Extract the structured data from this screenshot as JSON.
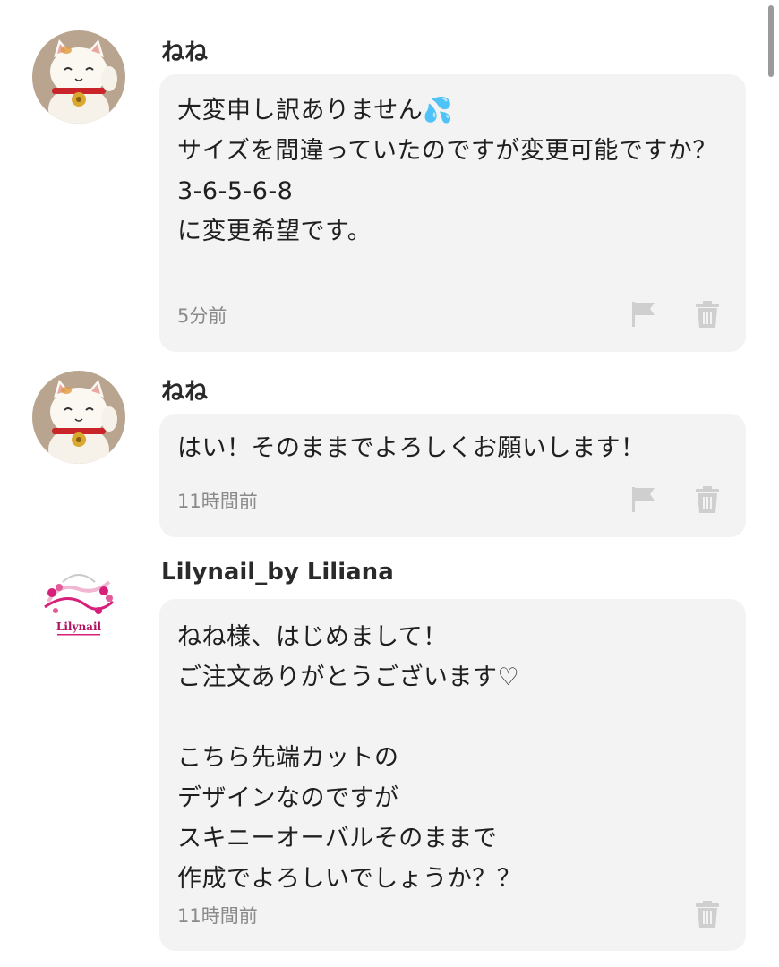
{
  "comments": [
    {
      "username": "ねね",
      "message": "大変申し訳ありません💦\nサイズを間違っていたのですが変更可能ですか？\n3-6-5-6-8\nに変更希望です。",
      "time": "5分前",
      "actions": [
        "flag-icon",
        "trash-icon"
      ]
    },
    {
      "username": "ねね",
      "message": "はい！そのままでよろしくお願いします！",
      "time": "11時間前",
      "actions": [
        "flag-icon",
        "trash-icon"
      ]
    },
    {
      "username": "Lilynail_by Liliana",
      "message": "ねね様、はじめまして！\nご注文ありがとうございます♡\n\nこちら先端カットの\nデザインなのですが\nスキニーオーバルそのままで\n作成でよろしいでしょうか？？",
      "time": "11時間前",
      "actions": [
        "trash-icon"
      ],
      "avatar_logo_text": "Lilynail"
    }
  ],
  "colors": {
    "bubble_bg": "#f3f3f3",
    "icon_gray": "#cfcfcf",
    "timestamp_gray": "#8a8a8a",
    "logo_pink": "#d6207a"
  }
}
